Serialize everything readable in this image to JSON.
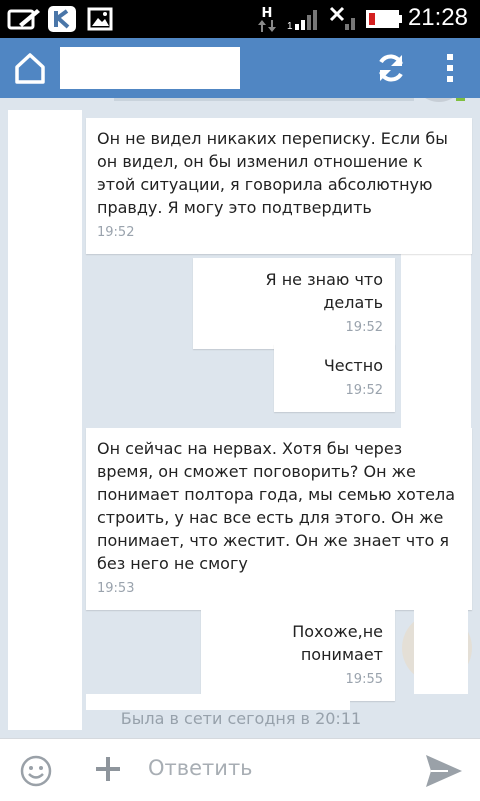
{
  "statusbar": {
    "network_letter": "H",
    "time": "21:28",
    "icons": [
      "edit-app-icon",
      "vk-app-icon",
      "gallery-icon",
      "data-transfer-icon",
      "signal-icon",
      "no-signal-icon",
      "battery-low-icon"
    ]
  },
  "actionbar": {
    "home_icon": "home-icon",
    "refresh_icon": "refresh-icon",
    "menu_icon": "more-vertical-icon"
  },
  "messages": [
    {
      "direction": "in",
      "text": "Он не видел никаких переписку. Если бы он видел, он бы изменил отношение к этой ситуации, я говорила абсолютную правду. Я могу это подтвердить",
      "time": "19:52"
    },
    {
      "direction": "out",
      "text": "Я не знаю что делать",
      "time": "19:52"
    },
    {
      "direction": "out",
      "text": "Честно",
      "time": "19:52"
    },
    {
      "direction": "in",
      "text": "Он сейчас на нервах. Хотя бы через время, он сможет поговорить? Он же понимает полтора года, мы семью хотела строить, у нас все есть для этого. Он же понимает, что жестит. Он же знает что я без него не смогу",
      "time": "19:53"
    },
    {
      "direction": "out",
      "text": "Похоже,не понимает",
      "time": "19:55"
    }
  ],
  "last_seen": "Была в сети сегодня в 20:11",
  "inputbar": {
    "placeholder": "Ответить",
    "emoji_icon": "emoji-icon",
    "attach_icon": "plus-icon",
    "send_icon": "send-icon"
  },
  "colors": {
    "actionbar": "#5086c3",
    "chat_background": "#dde5ed",
    "bubble": "#ffffff",
    "timestamp": "#9aa3ad"
  }
}
